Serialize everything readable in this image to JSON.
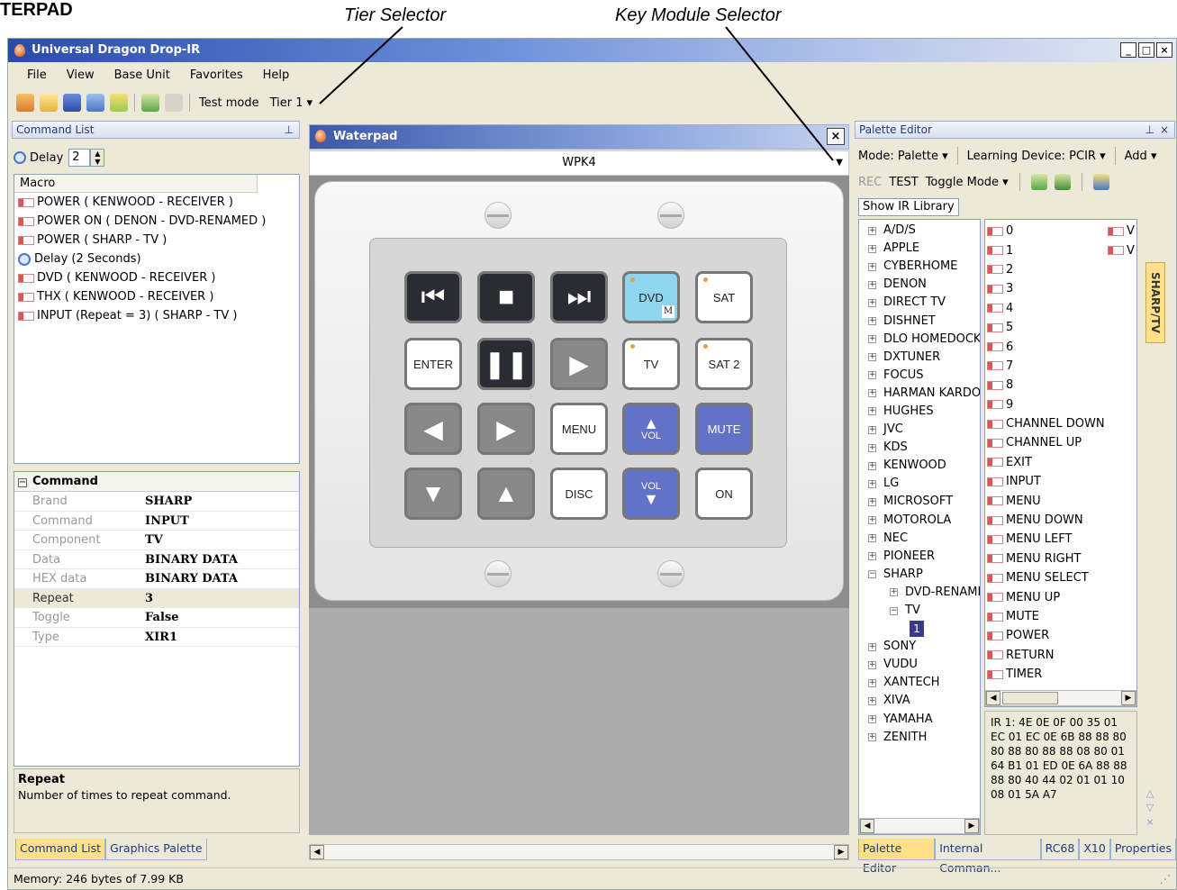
{
  "annotations": {
    "doc_title": "TERPAD",
    "tier_selector": "Tier Selector",
    "key_module_selector": "Key Module Selector"
  },
  "window": {
    "title": "Universal Dragon Drop-IR",
    "controls": [
      "_",
      "□",
      "×"
    ]
  },
  "menu": [
    "File",
    "View",
    "Base Unit",
    "Favorites",
    "Help"
  ],
  "toolbar": {
    "test_mode": "Test mode",
    "tier": "Tier 1"
  },
  "command_list": {
    "header": "Command List",
    "delay_label": "Delay",
    "delay_value": "2",
    "column": "Macro",
    "items": [
      {
        "icon": "ir-icon",
        "text": "POWER ( KENWOOD - RECEIVER )"
      },
      {
        "icon": "ir-icon",
        "text": "POWER ON ( DENON - DVD-RENAMED )"
      },
      {
        "icon": "ir-icon",
        "text": "POWER ( SHARP - TV )"
      },
      {
        "icon": "clock-icon",
        "text": "Delay (2 Seconds)"
      },
      {
        "icon": "ir-icon",
        "text": "DVD ( KENWOOD - RECEIVER )"
      },
      {
        "icon": "ir-icon",
        "text": "THX ( KENWOOD - RECEIVER )"
      },
      {
        "icon": "ir-icon",
        "text": "INPUT (Repeat = 3)  ( SHARP - TV )"
      }
    ]
  },
  "command_props": {
    "header": "Command",
    "rows": [
      {
        "key": "Brand",
        "value": "SHARP"
      },
      {
        "key": "Command",
        "value": "INPUT"
      },
      {
        "key": "Component",
        "value": "TV"
      },
      {
        "key": "Data",
        "value": "BINARY DATA"
      },
      {
        "key": "HEX data",
        "value": "BINARY DATA"
      },
      {
        "key": "Repeat",
        "value": "3"
      },
      {
        "key": "Toggle",
        "value": "False"
      },
      {
        "key": "Type",
        "value": "XIR1"
      }
    ],
    "help_title": "Repeat",
    "help_text": "Number of times to repeat command."
  },
  "left_tabs": [
    "Command List",
    "Graphics Palette"
  ],
  "waterpad": {
    "title": "Waterpad",
    "module": "WPK4",
    "buttons": {
      "enter": "ENTER",
      "dvd": "DVD",
      "dvd_badge": "M",
      "sat": "SAT",
      "tv": "TV",
      "sat2": "SAT 2",
      "menu": "MENU",
      "vol": "VOL",
      "mute": "MUTE",
      "disc": "DISC",
      "on": "ON"
    }
  },
  "palette_editor": {
    "header": "Palette Editor",
    "mode": "Mode: Palette",
    "learning": "Learning Device: PCIR",
    "add": "Add",
    "rec": "REC",
    "test": "TEST",
    "toggle_mode": "Toggle Mode",
    "show_ir": "Show IR Library",
    "brands_top": [
      "A/D/S",
      "APPLE",
      "CYBERHOME",
      "DENON",
      "DIRECT TV",
      "DISHNET",
      "DLO HOMEDOCK",
      "DXTUNER",
      "FOCUS",
      "HARMAN KARDON",
      "HUGHES",
      "JVC",
      "KDS",
      "KENWOOD",
      "LG",
      "MICROSOFT",
      "MOTOROLA",
      "NEC",
      "PIONEER",
      "SHARP"
    ],
    "sharp_children": [
      "DVD-RENAMED",
      "TV"
    ],
    "tv_child": "1",
    "brands_bottom": [
      "SONY",
      "VUDU",
      "XANTECH",
      "XIVA",
      "YAMAHA",
      "ZENITH"
    ],
    "commands": [
      "0",
      "1",
      "2",
      "3",
      "4",
      "5",
      "6",
      "7",
      "8",
      "9",
      "CHANNEL DOWN",
      "CHANNEL UP",
      "EXIT",
      "INPUT",
      "MENU",
      "MENU DOWN",
      "MENU LEFT",
      "MENU RIGHT",
      "MENU SELECT",
      "MENU UP",
      "MUTE",
      "POWER",
      "RETURN",
      "TIMER"
    ],
    "commands_right": [
      "V",
      "V"
    ],
    "side_tab": "SHARP/TV",
    "ir_data": "IR 1: 4E 0E 0F 00 35 01 EC 01 EC 0E 6B 88 88 80 80 88 80 88 88 08 80 01 64 B1 01 ED 0E 6A 88 88 88 80 40 44 02 01 01 10 08 01 5A A7"
  },
  "right_tabs": [
    "Palette Editor",
    "Internal Comman...",
    "RC68",
    "X10",
    "Properties"
  ],
  "status": "Memory: 246 bytes of 7.99 KB"
}
